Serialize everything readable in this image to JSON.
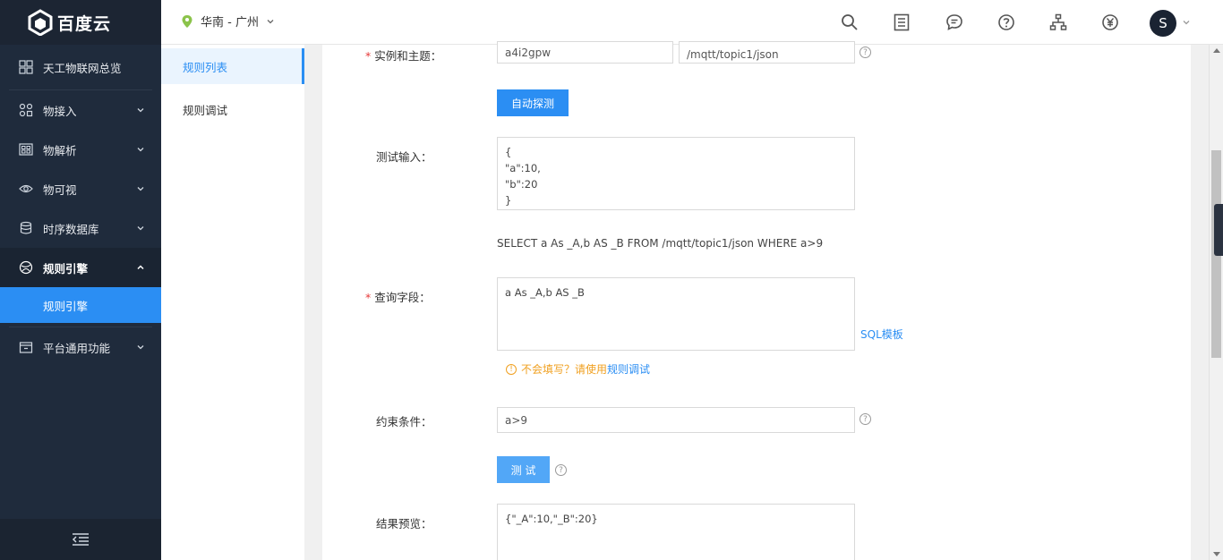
{
  "brand": {
    "name": "百度云"
  },
  "sidebar": {
    "overview": "天工物联网总览",
    "items": [
      {
        "label": "物接入",
        "icon": "device-access-icon"
      },
      {
        "label": "物解析",
        "icon": "parse-icon"
      },
      {
        "label": "物可视",
        "icon": "eye-icon"
      },
      {
        "label": "时序数据库",
        "icon": "database-icon"
      },
      {
        "label": "规则引擎",
        "icon": "rule-engine-icon"
      },
      {
        "label": "平台通用功能",
        "icon": "platform-icon"
      }
    ],
    "active_sub": "规则引擎"
  },
  "header": {
    "region": "华南 - 广州",
    "avatar_letter": "S"
  },
  "submenu": {
    "items": [
      "规则列表",
      "规则调试"
    ]
  },
  "form": {
    "instance_label": "实例和主题：",
    "instance_value": "a4i2gpw",
    "topic_value": "/mqtt/topic1/json",
    "auto_detect_btn": "自动探测",
    "test_input_label": "测试输入：",
    "test_input_value": "{\n\"a\":10,\n\"b\":20\n}",
    "sql_preview": "SELECT a As _A,b AS _B FROM /mqtt/topic1/json WHERE a>9",
    "query_label": "查询字段：",
    "query_value": "a As _A,b AS _B",
    "sql_template_link": "SQL模板",
    "hint_text": "不会填写？请使用",
    "hint_link": "规则调试",
    "condition_label": "约束条件：",
    "condition_value": "a>9",
    "test_btn": "测 试",
    "result_label": "结果预览：",
    "result_value": "{\"_A\":10,\"_B\":20}"
  },
  "colors": {
    "sidebar_bg": "#1f2b3c",
    "accent": "#2b8ef3",
    "warning": "#f0a020",
    "required": "#e63838"
  }
}
